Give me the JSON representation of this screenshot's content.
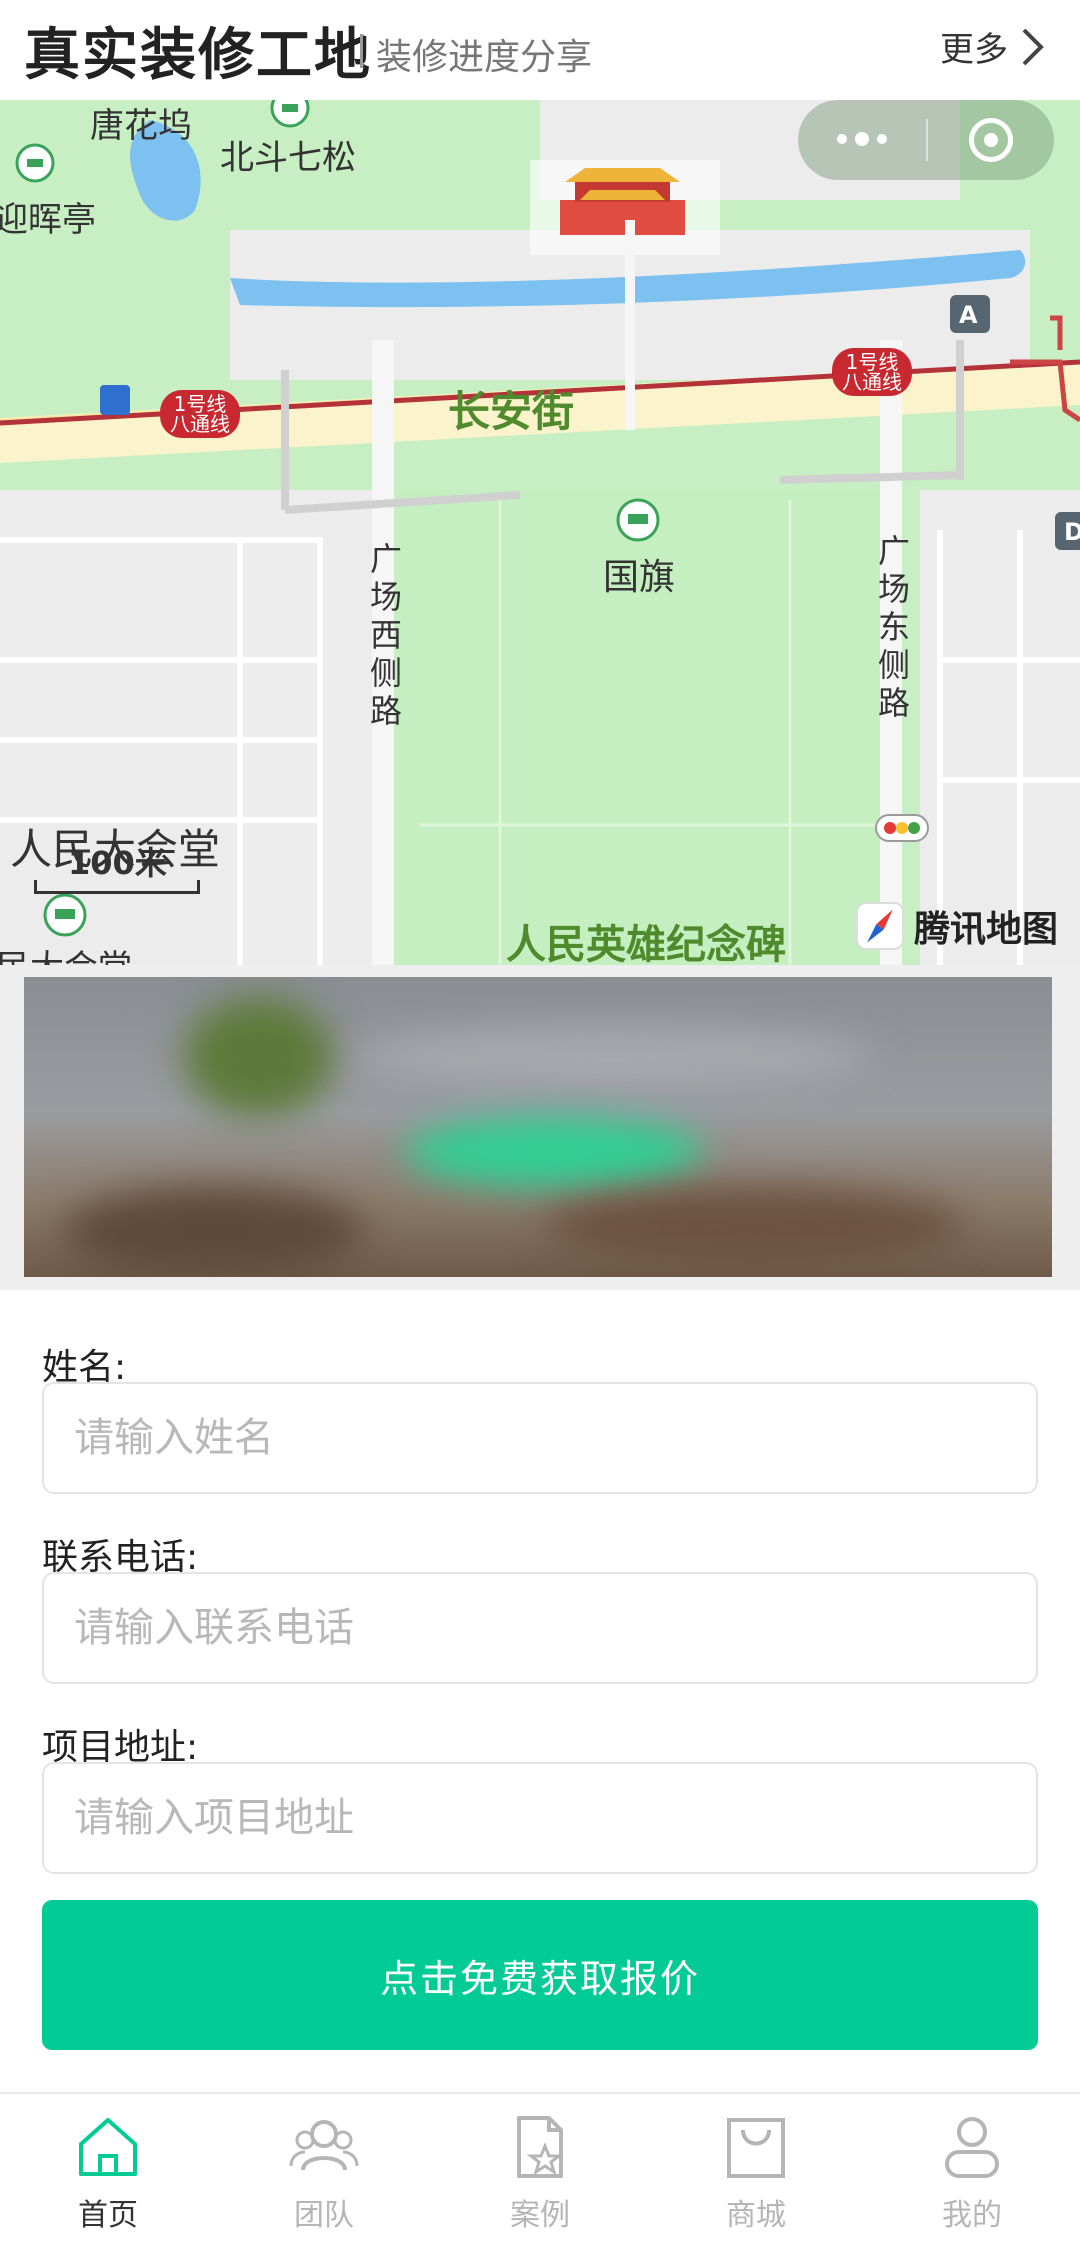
{
  "header": {
    "title": "真实装修工地",
    "subtitle": "装修进度分享",
    "more_label": "更多"
  },
  "map": {
    "labels": {
      "tanghuawu": "唐花坞",
      "beidou": "北斗七松",
      "yinghuiting": "迎晖亭",
      "changanjie": "长安街",
      "guoqi": "国旗",
      "west_road": "广场西侧路",
      "east_road": "广场东侧路",
      "great_hall": "人民大会堂",
      "great_hall_partial": "民大会堂",
      "monument": "人民英雄纪念碑",
      "scale": "100米",
      "exit_a": "A",
      "exit_d": "D"
    },
    "line_badge_1": {
      "line1": "1号线",
      "line2": "八通线"
    },
    "line_badge_2": {
      "line1": "1号线",
      "line2": "八通线"
    },
    "watermark": "腾讯地图"
  },
  "form": {
    "name_label": "姓名:",
    "name_placeholder": "请输入姓名",
    "phone_label": "联系电话:",
    "phone_placeholder": "请输入联系电话",
    "address_label": "项目地址:",
    "address_placeholder": "请输入项目地址",
    "submit_label": "点击免费获取报价"
  },
  "tabbar": {
    "items": [
      {
        "label": "首页",
        "icon": "home-icon",
        "active": true
      },
      {
        "label": "团队",
        "icon": "team-icon",
        "active": false
      },
      {
        "label": "案例",
        "icon": "case-icon",
        "active": false
      },
      {
        "label": "商城",
        "icon": "shop-icon",
        "active": false
      },
      {
        "label": "我的",
        "icon": "profile-icon",
        "active": false
      }
    ]
  },
  "colors": {
    "accent": "#02cb96",
    "map_green": "#c7efc3",
    "road": "#fbf3cc",
    "metro_red": "#c8282f",
    "water": "#7cc1ef"
  }
}
